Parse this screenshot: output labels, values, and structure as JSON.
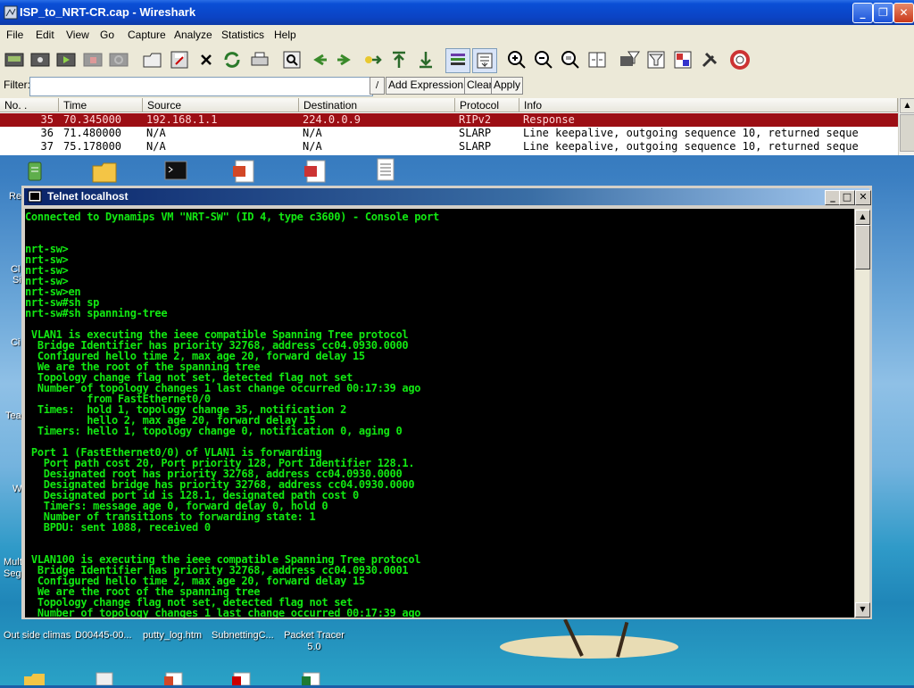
{
  "desktop": {
    "icons_bottom": [
      {
        "label": "Out side climas"
      },
      {
        "label": "D00445-00..."
      },
      {
        "label": "putty_log.htm"
      },
      {
        "label": "SubnettingC..."
      },
      {
        "label": "Packet Tracer 5.0"
      }
    ],
    "left_partial_labels": [
      "Re",
      "Cl",
      "Si",
      "Ci",
      "Tea",
      "W",
      "Mult",
      "Seg"
    ]
  },
  "wireshark": {
    "title": "ISP_to_NRT-CR.cap - Wireshark",
    "menu": [
      "File",
      "Edit",
      "View",
      "Go",
      "Capture",
      "Analyze",
      "Statistics",
      "Help"
    ],
    "toolbar_icons": [
      "interfaces-icon",
      "capture-options-icon",
      "start-capture-icon",
      "stop-capture-icon",
      "restart-capture-icon",
      "open-icon",
      "save-icon",
      "close-icon",
      "reload-icon",
      "print-icon",
      "find-icon",
      "back-icon",
      "forward-icon",
      "goto-icon",
      "first-icon",
      "last-icon",
      "colorize-icon",
      "autoscroll-icon",
      "zoom-in-icon",
      "zoom-out-icon",
      "zoom-normal-icon",
      "resize-columns-icon",
      "capture-filters-icon",
      "display-filters-icon",
      "coloring-rules-icon",
      "preferences-icon",
      "help-icon"
    ],
    "filter": {
      "label": "Filter:",
      "value": "",
      "expression_label": "Add Expression...",
      "clear_label": "Clear",
      "apply_label": "Apply"
    },
    "columns": [
      "No. .",
      "Time",
      "Source",
      "Destination",
      "Protocol",
      "Info"
    ],
    "packets": [
      {
        "no": "35",
        "time": "70.345000",
        "source": "192.168.1.1",
        "destination": "224.0.0.9",
        "protocol": "RIPv2",
        "info": "Response",
        "selected": true
      },
      {
        "no": "36",
        "time": "71.480000",
        "source": "N/A",
        "destination": "N/A",
        "protocol": "SLARP",
        "info": "Line keepalive, outgoing sequence 10, returned seque",
        "selected": false
      },
      {
        "no": "37",
        "time": "75.178000",
        "source": "N/A",
        "destination": "N/A",
        "protocol": "SLARP",
        "info": "Line keepalive, outgoing sequence 10, returned seque",
        "selected": false
      }
    ]
  },
  "telnet": {
    "title": "Telnet localhost",
    "lines": [
      "Connected to Dynamips VM \"NRT-SW\" (ID 4, type c3600) - Console port",
      "",
      "",
      "nrt-sw>",
      "nrt-sw>",
      "nrt-sw>",
      "nrt-sw>",
      "nrt-sw>en",
      "nrt-sw#sh sp",
      "nrt-sw#sh spanning-tree",
      "",
      " VLAN1 is executing the ieee compatible Spanning Tree protocol",
      "  Bridge Identifier has priority 32768, address cc04.0930.0000",
      "  Configured hello time 2, max age 20, forward delay 15",
      "  We are the root of the spanning tree",
      "  Topology change flag not set, detected flag not set",
      "  Number of topology changes 1 last change occurred 00:17:39 ago",
      "          from FastEthernet0/0",
      "  Times:  hold 1, topology change 35, notification 2",
      "          hello 2, max age 20, forward delay 15",
      "  Timers: hello 1, topology change 0, notification 0, aging 0",
      "",
      " Port 1 (FastEthernet0/0) of VLAN1 is forwarding",
      "   Port path cost 20, Port priority 128, Port Identifier 128.1.",
      "   Designated root has priority 32768, address cc04.0930.0000",
      "   Designated bridge has priority 32768, address cc04.0930.0000",
      "   Designated port id is 128.1, designated path cost 0",
      "   Timers: message age 0, forward delay 0, hold 0",
      "   Number of transitions to forwarding state: 1",
      "   BPDU: sent 1088, received 0",
      "",
      "",
      " VLAN100 is executing the ieee compatible Spanning Tree protocol",
      "  Bridge Identifier has priority 32768, address cc04.0930.0001",
      "  Configured hello time 2, max age 20, forward delay 15",
      "  We are the root of the spanning tree",
      "  Topology change flag not set, detected flag not set",
      "  Number of topology changes 1 last change occurred 00:17:39 ago"
    ]
  },
  "colors": {
    "console_text": "#12e812",
    "console_bg": "#000000",
    "selected_row_bg": "#9c0e14",
    "titlebar": "#0b43c4"
  }
}
